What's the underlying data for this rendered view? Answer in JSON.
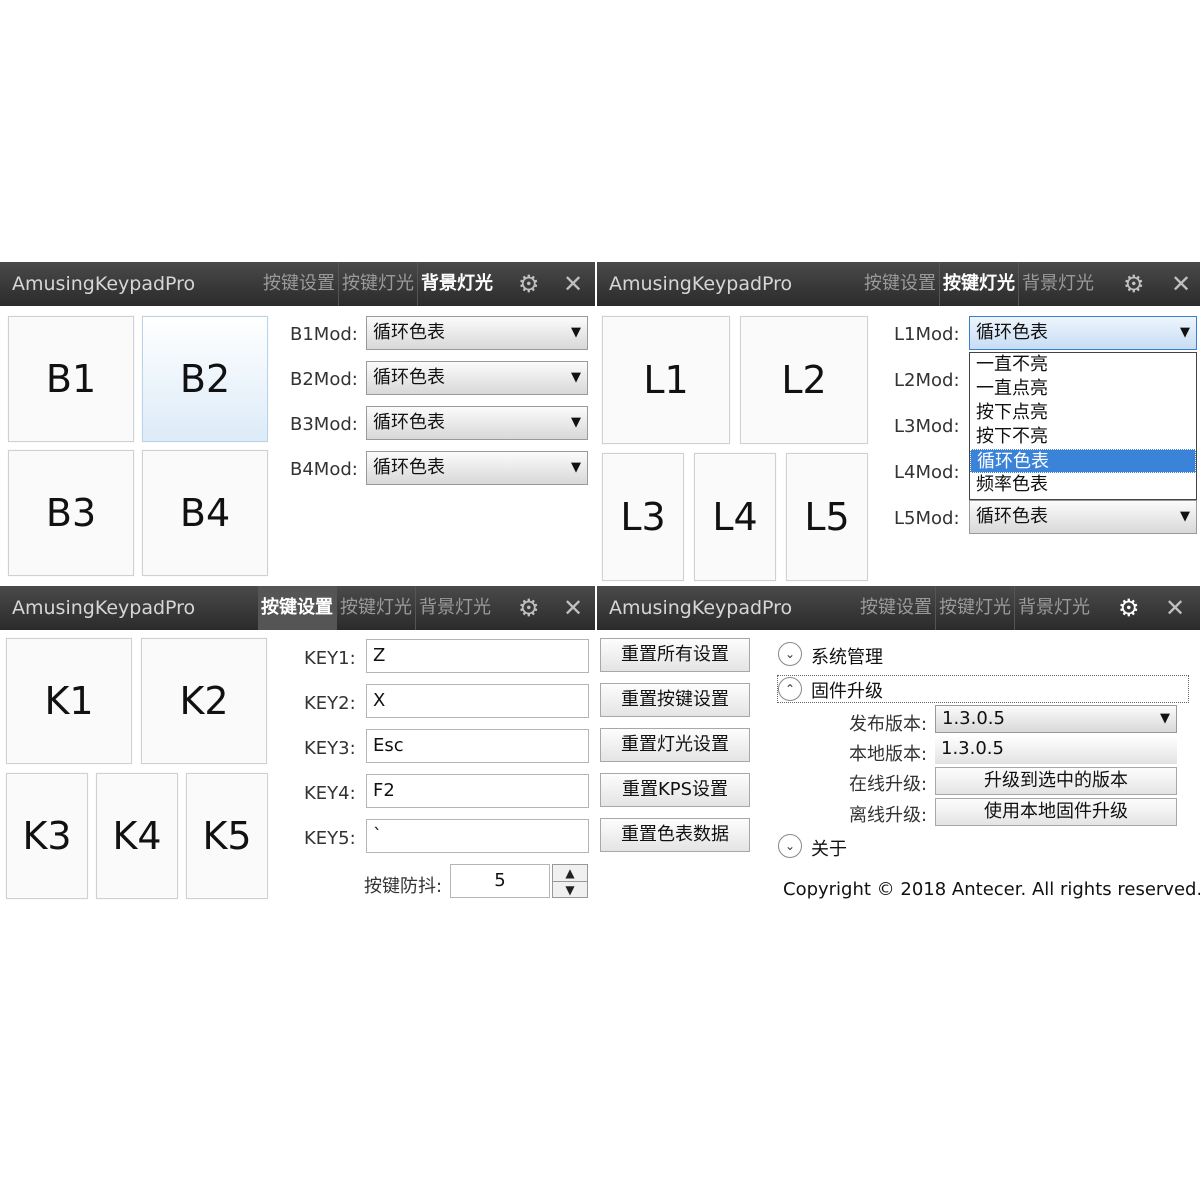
{
  "app_title": "AmusingKeypadPro",
  "tabs": [
    "按键设置",
    "按键灯光",
    "背景灯光"
  ],
  "icons": {
    "settings": "gear-icon",
    "close": "close-icon"
  },
  "panel_b": {
    "keys": [
      "B1",
      "B2",
      "B3",
      "B4"
    ],
    "mods": [
      {
        "label": "B1Mod:",
        "value": "循环色表"
      },
      {
        "label": "B2Mod:",
        "value": "循环色表"
      },
      {
        "label": "B3Mod:",
        "value": "循环色表"
      },
      {
        "label": "B4Mod:",
        "value": "循环色表"
      }
    ]
  },
  "panel_l": {
    "keys": [
      "L1",
      "L2",
      "L3",
      "L4",
      "L5"
    ],
    "mods": [
      {
        "label": "L1Mod:",
        "value": "循环色表"
      },
      {
        "label": "L2Mod:"
      },
      {
        "label": "L3Mod:"
      },
      {
        "label": "L4Mod:"
      },
      {
        "label": "L5Mod:",
        "value": "循环色表"
      }
    ],
    "dropdown_options": [
      "一直不亮",
      "一直点亮",
      "按下点亮",
      "按下不亮",
      "循环色表",
      "频率色表"
    ],
    "selected_option": "循环色表"
  },
  "panel_k": {
    "keys": [
      "K1",
      "K2",
      "K3",
      "K4",
      "K5"
    ],
    "fields": [
      {
        "label": "KEY1:",
        "value": "Z"
      },
      {
        "label": "KEY2:",
        "value": "X"
      },
      {
        "label": "KEY3:",
        "value": "Esc"
      },
      {
        "label": "KEY4:",
        "value": "F2"
      },
      {
        "label": "KEY5:",
        "value": "`"
      }
    ],
    "debounce_label": "按键防抖:",
    "debounce_value": "5"
  },
  "panel_s": {
    "reset_buttons": [
      "重置所有设置",
      "重置按键设置",
      "重置灯光设置",
      "重置KPS设置",
      "重置色表数据"
    ],
    "section_system": "系统管理",
    "section_firmware": "固件升级",
    "release_label": "发布版本:",
    "release_value": "1.3.0.5",
    "local_label": "本地版本:",
    "local_value": "1.3.0.5",
    "online_label": "在线升级:",
    "online_button": "升级到选中的版本",
    "offline_label": "离线升级:",
    "offline_button": "使用本地固件升级",
    "section_about": "关于",
    "copyright": "Copyright ©  2018 Antecer. All rights reserved."
  }
}
